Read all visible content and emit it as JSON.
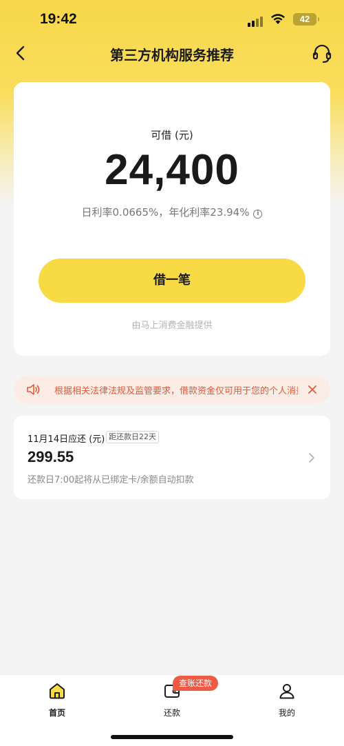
{
  "status_bar": {
    "time": "19:42",
    "battery": "42"
  },
  "nav": {
    "title": "第三方机构服务推荐"
  },
  "loan": {
    "label": "可借 (元)",
    "amount": "24,400",
    "rate_text": "日利率0.0665%，年化利率23.94%",
    "button_label": "借一笔",
    "provider": "由马上消费金融提供"
  },
  "notice": {
    "text": "根据相关法律法规及监管要求，借款资金仅可用于您的个人消费，不得用于购房、投资等"
  },
  "repayment": {
    "title": "11月14日应还 (元)",
    "badge": "距还款日22天",
    "amount": "299.55",
    "note": "还款日7:00起将从已绑定卡/余额自动扣款"
  },
  "tabs": [
    {
      "label": "首页",
      "icon": "home-icon",
      "active": true
    },
    {
      "label": "还款",
      "icon": "wallet-icon",
      "badge": "查账还款"
    },
    {
      "label": "我的",
      "icon": "user-icon"
    }
  ],
  "colors": {
    "brand_yellow": "#f8da45",
    "notice_red": "#e05a3c",
    "badge_red": "#ef5a45"
  }
}
